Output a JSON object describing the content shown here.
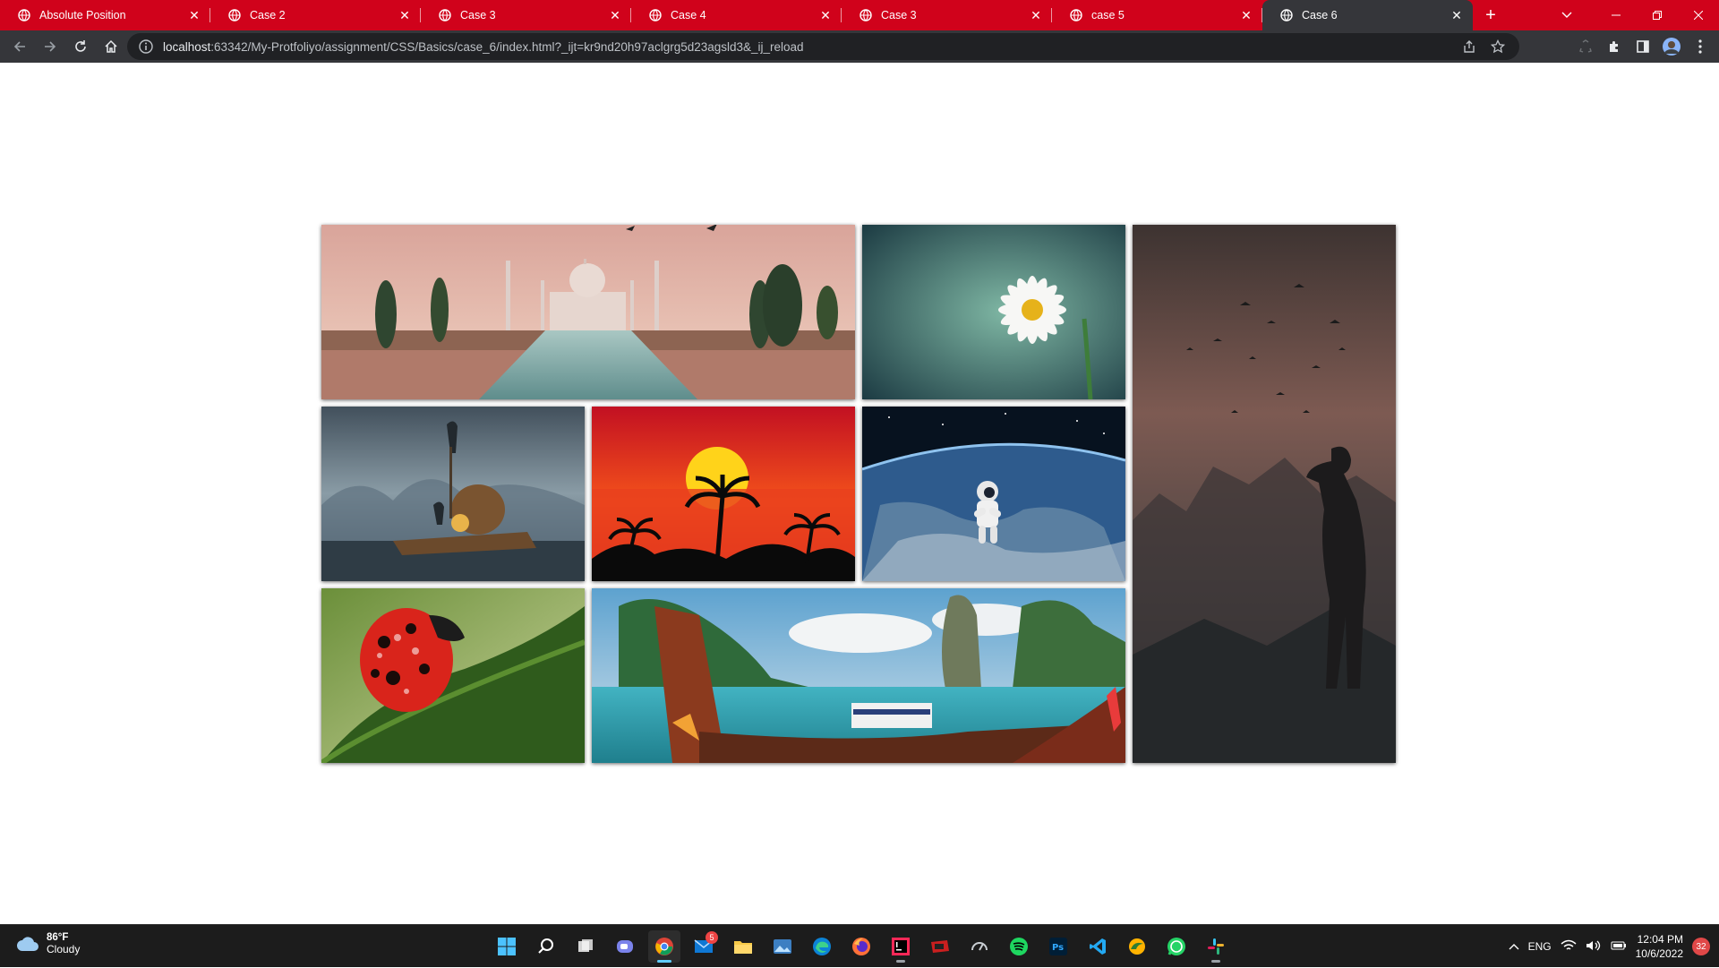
{
  "browser": {
    "tabs": [
      {
        "title": "Absolute Position",
        "active": false
      },
      {
        "title": "Case 2",
        "active": false
      },
      {
        "title": "Case 3",
        "active": false
      },
      {
        "title": "Case 4",
        "active": false
      },
      {
        "title": "Case 3",
        "active": false
      },
      {
        "title": "case 5",
        "active": false
      },
      {
        "title": "Case 6",
        "active": true
      }
    ],
    "close_glyph": "✕",
    "new_tab_glyph": "+",
    "url_host": "localhost",
    "url_rest": ":63342/My-Protfoliyo/assignment/CSS/Basics/case_6/index.html?_ijt=kr9nd20h97aclgrg5d23agsld3&_ij_reload",
    "accent_color": "#d0021b",
    "toolbar_color": "#35363a"
  },
  "gallery": {
    "images": [
      {
        "subject": "Taj Mahal with reflecting pool"
      },
      {
        "subject": "White daisy on teal background"
      },
      {
        "subject": "Silhouette of man with cap on misty hill with birds"
      },
      {
        "subject": "Cormorant fisherman on bamboo raft"
      },
      {
        "subject": "Palm trees silhouette at red sunset"
      },
      {
        "subject": "Astronaut floating above Earth"
      },
      {
        "subject": "Ladybug with water droplets on leaf"
      },
      {
        "subject": "Longtail boat in tropical bay with limestone cliffs"
      }
    ]
  },
  "taskbar": {
    "weather_temp": "86°F",
    "weather_desc": "Cloudy",
    "apps": [
      "start-icon",
      "search-icon",
      "task-view-icon",
      "teams-chat-icon",
      "chrome-icon",
      "mail-icon",
      "file-explorer-icon",
      "photos-icon",
      "edge-icon",
      "firefox-icon",
      "intellij-icon",
      "app-red-icon",
      "speedometer-icon",
      "spotify-icon",
      "photoshop-icon",
      "vscode-icon",
      "app-swirl-icon",
      "whatsapp-icon",
      "slack-icon"
    ],
    "mail_badge": "5",
    "language": "ENG",
    "time": "12:04 PM",
    "date": "10/6/2022",
    "notification_count": "32"
  }
}
